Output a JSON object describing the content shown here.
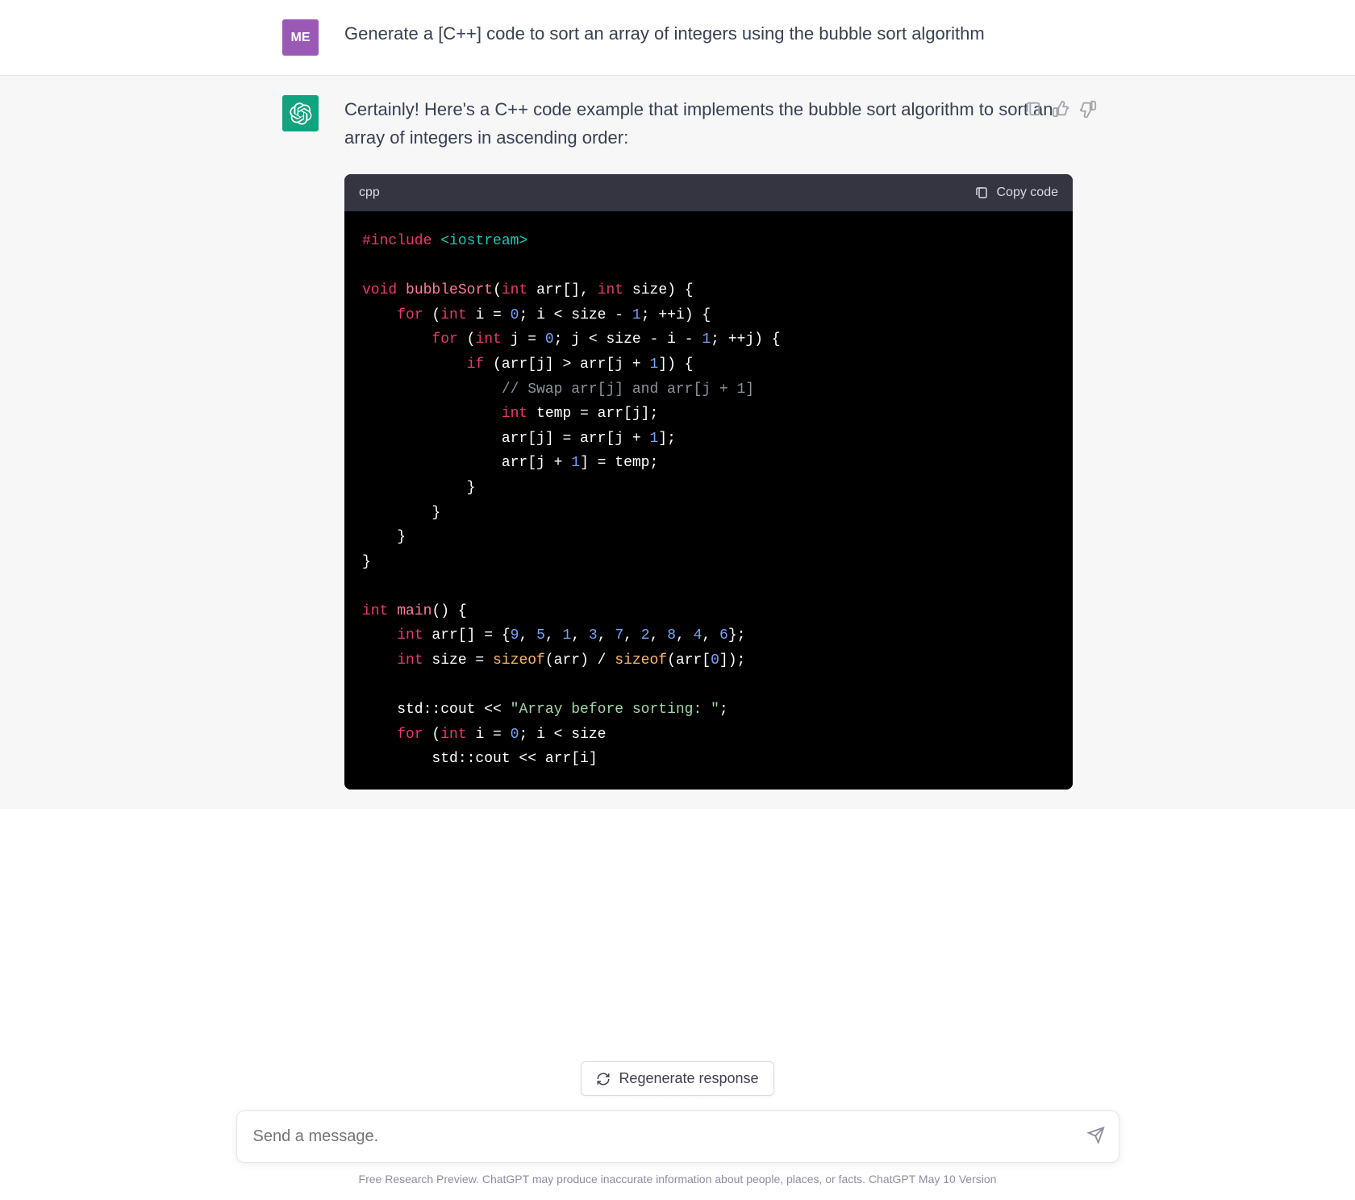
{
  "user": {
    "avatar_label": "ME",
    "message": "Generate a [C++] code to sort an array of integers using the bubble sort algorithm"
  },
  "assistant": {
    "intro": "Certainly! Here's a C++ code example that implements the bubble sort algorithm to sort an array of integers in ascending order:",
    "code": {
      "language": "cpp",
      "copy_label": "Copy code",
      "tokens": [
        [
          {
            "t": "preproc",
            "v": "#include"
          },
          {
            "t": "plain",
            "v": " "
          },
          {
            "t": "inc",
            "v": "<iostream>"
          }
        ],
        [],
        [
          {
            "t": "type",
            "v": "void"
          },
          {
            "t": "plain",
            "v": " "
          },
          {
            "t": "func",
            "v": "bubbleSort"
          },
          {
            "t": "plain",
            "v": "("
          },
          {
            "t": "type",
            "v": "int"
          },
          {
            "t": "plain",
            "v": " arr[], "
          },
          {
            "t": "type",
            "v": "int"
          },
          {
            "t": "plain",
            "v": " size) {"
          }
        ],
        [
          {
            "t": "plain",
            "v": "    "
          },
          {
            "t": "keyword",
            "v": "for"
          },
          {
            "t": "plain",
            "v": " ("
          },
          {
            "t": "type",
            "v": "int"
          },
          {
            "t": "plain",
            "v": " i = "
          },
          {
            "t": "num",
            "v": "0"
          },
          {
            "t": "plain",
            "v": "; i < size - "
          },
          {
            "t": "num",
            "v": "1"
          },
          {
            "t": "plain",
            "v": "; ++i) {"
          }
        ],
        [
          {
            "t": "plain",
            "v": "        "
          },
          {
            "t": "keyword",
            "v": "for"
          },
          {
            "t": "plain",
            "v": " ("
          },
          {
            "t": "type",
            "v": "int"
          },
          {
            "t": "plain",
            "v": " j = "
          },
          {
            "t": "num",
            "v": "0"
          },
          {
            "t": "plain",
            "v": "; j < size - i - "
          },
          {
            "t": "num",
            "v": "1"
          },
          {
            "t": "plain",
            "v": "; ++j) {"
          }
        ],
        [
          {
            "t": "plain",
            "v": "            "
          },
          {
            "t": "keyword",
            "v": "if"
          },
          {
            "t": "plain",
            "v": " (arr[j] > arr[j + "
          },
          {
            "t": "num",
            "v": "1"
          },
          {
            "t": "plain",
            "v": "]) {"
          }
        ],
        [
          {
            "t": "plain",
            "v": "                "
          },
          {
            "t": "comment",
            "v": "// Swap arr[j] and arr[j + 1]"
          }
        ],
        [
          {
            "t": "plain",
            "v": "                "
          },
          {
            "t": "type",
            "v": "int"
          },
          {
            "t": "plain",
            "v": " temp = arr[j];"
          }
        ],
        [
          {
            "t": "plain",
            "v": "                arr[j] = arr[j + "
          },
          {
            "t": "num",
            "v": "1"
          },
          {
            "t": "plain",
            "v": "];"
          }
        ],
        [
          {
            "t": "plain",
            "v": "                arr[j + "
          },
          {
            "t": "num",
            "v": "1"
          },
          {
            "t": "plain",
            "v": "] = temp;"
          }
        ],
        [
          {
            "t": "plain",
            "v": "            }"
          }
        ],
        [
          {
            "t": "plain",
            "v": "        }"
          }
        ],
        [
          {
            "t": "plain",
            "v": "    }"
          }
        ],
        [
          {
            "t": "plain",
            "v": "}"
          }
        ],
        [],
        [
          {
            "t": "type",
            "v": "int"
          },
          {
            "t": "plain",
            "v": " "
          },
          {
            "t": "func",
            "v": "main"
          },
          {
            "t": "plain",
            "v": "() {"
          }
        ],
        [
          {
            "t": "plain",
            "v": "    "
          },
          {
            "t": "type",
            "v": "int"
          },
          {
            "t": "plain",
            "v": " arr[] = {"
          },
          {
            "t": "num",
            "v": "9"
          },
          {
            "t": "plain",
            "v": ", "
          },
          {
            "t": "num",
            "v": "5"
          },
          {
            "t": "plain",
            "v": ", "
          },
          {
            "t": "num",
            "v": "1"
          },
          {
            "t": "plain",
            "v": ", "
          },
          {
            "t": "num",
            "v": "3"
          },
          {
            "t": "plain",
            "v": ", "
          },
          {
            "t": "num",
            "v": "7"
          },
          {
            "t": "plain",
            "v": ", "
          },
          {
            "t": "num",
            "v": "2"
          },
          {
            "t": "plain",
            "v": ", "
          },
          {
            "t": "num",
            "v": "8"
          },
          {
            "t": "plain",
            "v": ", "
          },
          {
            "t": "num",
            "v": "4"
          },
          {
            "t": "plain",
            "v": ", "
          },
          {
            "t": "num",
            "v": "6"
          },
          {
            "t": "plain",
            "v": "};"
          }
        ],
        [
          {
            "t": "plain",
            "v": "    "
          },
          {
            "t": "type",
            "v": "int"
          },
          {
            "t": "plain",
            "v": " size = "
          },
          {
            "t": "builtin",
            "v": "sizeof"
          },
          {
            "t": "plain",
            "v": "(arr) / "
          },
          {
            "t": "builtin",
            "v": "sizeof"
          },
          {
            "t": "plain",
            "v": "(arr["
          },
          {
            "t": "num",
            "v": "0"
          },
          {
            "t": "plain",
            "v": "]);"
          }
        ],
        [],
        [
          {
            "t": "plain",
            "v": "    std::cout << "
          },
          {
            "t": "str",
            "v": "\"Array before sorting: \""
          },
          {
            "t": "plain",
            "v": ";"
          }
        ],
        [
          {
            "t": "plain",
            "v": "    "
          },
          {
            "t": "keyword",
            "v": "for"
          },
          {
            "t": "plain",
            "v": " ("
          },
          {
            "t": "type",
            "v": "int"
          },
          {
            "t": "plain",
            "v": " i = "
          },
          {
            "t": "num",
            "v": "0"
          },
          {
            "t": "plain",
            "v": "; i < size"
          }
        ],
        [
          {
            "t": "plain",
            "v": "        std::cout << arr[i]"
          }
        ]
      ]
    }
  },
  "controls": {
    "regenerate_label": "Regenerate response",
    "input_placeholder": "Send a message.",
    "footer_note": "Free Research Preview. ChatGPT may produce inaccurate information about people, places, or facts. ChatGPT May 10 Version"
  },
  "icons": {
    "clipboard": "clipboard-icon",
    "thumbs_up": "thumbs-up-icon",
    "thumbs_down": "thumbs-down-icon",
    "refresh": "refresh-icon",
    "send": "send-icon"
  }
}
